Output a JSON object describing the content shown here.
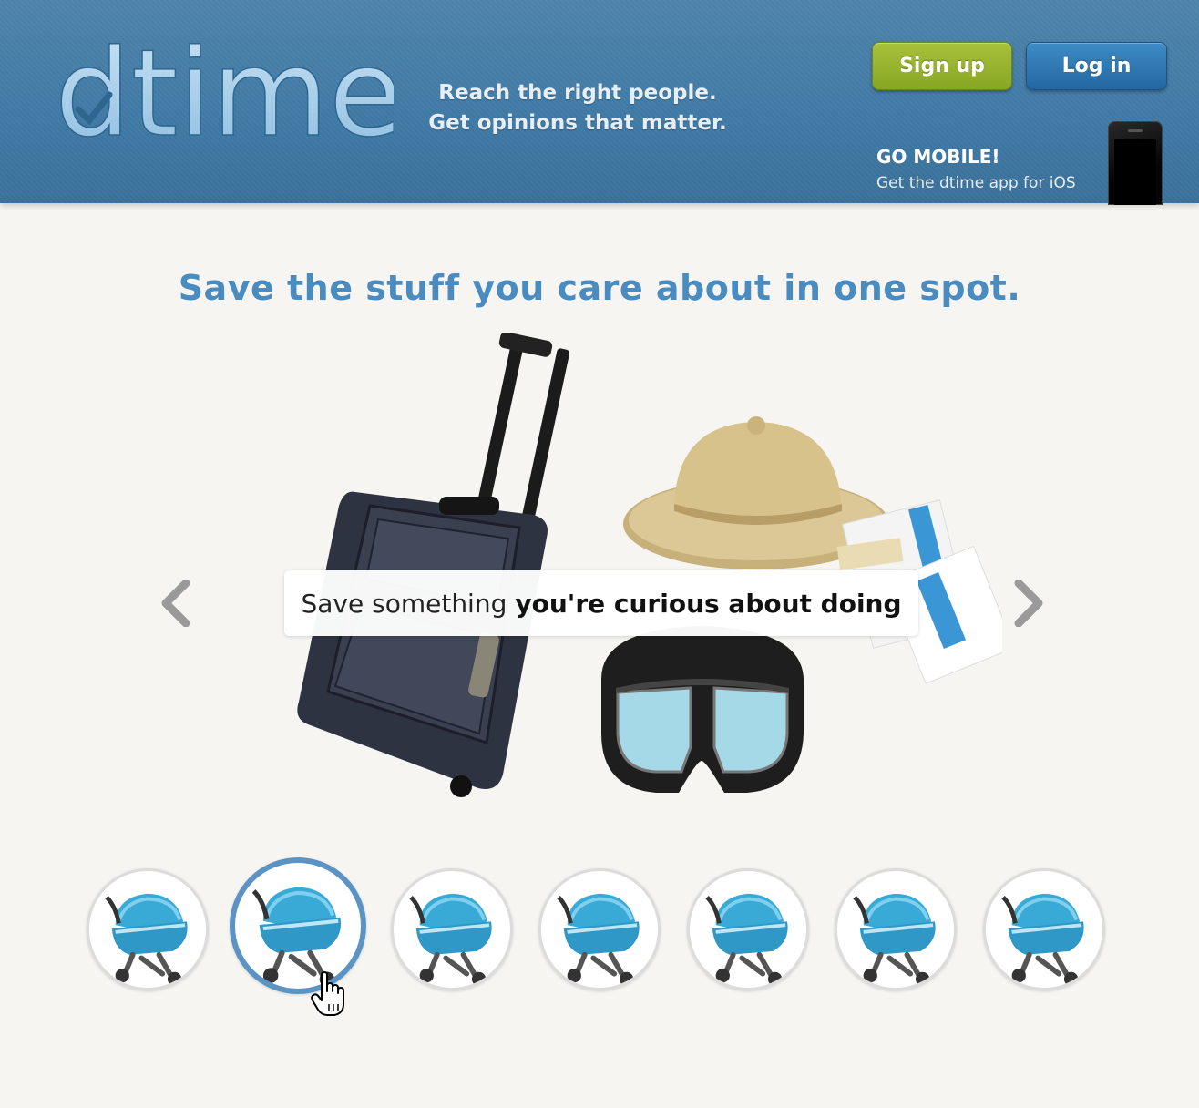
{
  "header": {
    "logo_text": "dtime",
    "tagline_line1": "Reach the right people.",
    "tagline_line2": "Get opinions that matter.",
    "signup_label": "Sign up",
    "login_label": "Log in",
    "mobile_title": "GO MOBILE!",
    "mobile_subtitle": "Get the dtime app for iOS"
  },
  "main": {
    "headline": "Save the stuff you care about in one spot.",
    "caption_prefix": "Save something",
    "caption_emphasis": "you're curious about doing",
    "prev_icon": "chevron-left-icon",
    "next_icon": "chevron-right-icon"
  },
  "thumbnails": {
    "count": 7,
    "active_index": 1,
    "icon": "stroller-icon"
  },
  "colors": {
    "header_bg": "#3f7aa6",
    "headline": "#4a8cc0",
    "signup_green": "#93b02c",
    "login_blue": "#2c74ae",
    "active_ring": "#5b93c4"
  }
}
